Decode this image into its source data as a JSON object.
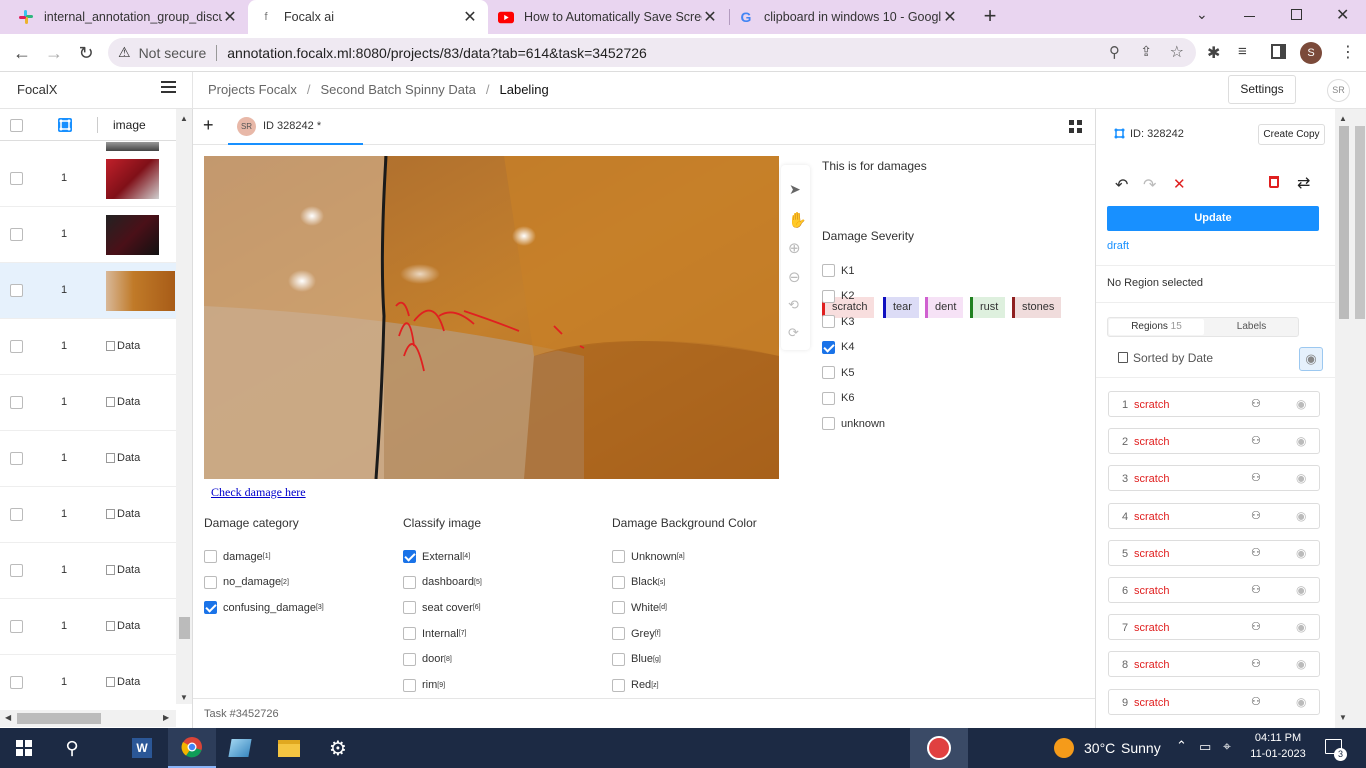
{
  "browser": {
    "tabs": [
      {
        "title": "internal_annotation_group_discu",
        "icon": "slack-icon",
        "active": false
      },
      {
        "title": "Focalx ai",
        "icon": "focalx-icon",
        "active": true
      },
      {
        "title": "How to Automatically Save Scree",
        "icon": "youtube-icon",
        "active": false
      },
      {
        "title": "clipboard in windows 10 - Googl",
        "icon": "google-icon",
        "active": false
      }
    ],
    "security_label": "Not secure",
    "url": "annotation.focalx.ml:8080/projects/83/data?tab=614&task=3452726",
    "profile_initial": "S"
  },
  "app": {
    "logo": "FocalX",
    "breadcrumb": [
      "Projects Focalx",
      "Second Batch Spinny Data",
      "Labeling"
    ],
    "breadcrumb_sep": "/",
    "settings_label": "Settings",
    "user_initials": "SR"
  },
  "list": {
    "column_image": "image",
    "rows": [
      {
        "count": "1",
        "thumb": "red-car"
      },
      {
        "count": "1",
        "thumb": "dark-car"
      },
      {
        "count": "1",
        "thumb": "orange-car",
        "selected": true
      },
      {
        "count": "1",
        "thumb": "broken",
        "alt": "Data"
      },
      {
        "count": "1",
        "thumb": "broken",
        "alt": "Data"
      },
      {
        "count": "1",
        "thumb": "broken",
        "alt": "Data"
      },
      {
        "count": "1",
        "thumb": "broken",
        "alt": "Data"
      },
      {
        "count": "1",
        "thumb": "broken",
        "alt": "Data"
      },
      {
        "count": "1",
        "thumb": "broken",
        "alt": "Data"
      },
      {
        "count": "1",
        "thumb": "broken",
        "alt": "Data"
      }
    ]
  },
  "editor": {
    "tab_initials": "SR",
    "tab_label": "ID 328242 *",
    "add_label": "+",
    "link_text": "Check damage here",
    "task_label": "Task #3452726",
    "damages_title": "This is for damages",
    "damage_tags": [
      {
        "label": "scratch",
        "color": "#e02020",
        "bg": "#f8dede"
      },
      {
        "label": "tear",
        "color": "#1010c0",
        "bg": "#dcdcf6"
      },
      {
        "label": "dent",
        "color": "#d060d0",
        "bg": "#f6e2f6"
      },
      {
        "label": "rust",
        "color": "#208020",
        "bg": "#def0de"
      },
      {
        "label": "stones",
        "color": "#902020",
        "bg": "#f0dcdc"
      }
    ],
    "severity_title": "Damage Severity",
    "severity": [
      {
        "label": "K1",
        "checked": false
      },
      {
        "label": "K2",
        "checked": false
      },
      {
        "label": "K3",
        "checked": false
      },
      {
        "label": "K4",
        "checked": true
      },
      {
        "label": "K5",
        "checked": false
      },
      {
        "label": "K6",
        "checked": false
      },
      {
        "label": "unknown",
        "checked": false
      }
    ],
    "category_title": "Damage category",
    "category": [
      {
        "label": "damage",
        "key": "[1]",
        "checked": false
      },
      {
        "label": "no_damage",
        "key": "[2]",
        "checked": false
      },
      {
        "label": "confusing_damage",
        "key": "[3]",
        "checked": true
      }
    ],
    "classify_title": "Classify image",
    "classify": [
      {
        "label": "External",
        "key": "[4]",
        "checked": true
      },
      {
        "label": "dashboard",
        "key": "[5]",
        "checked": false
      },
      {
        "label": "seat cover",
        "key": "[6]",
        "checked": false
      },
      {
        "label": "Internal",
        "key": "[7]",
        "checked": false
      },
      {
        "label": "door",
        "key": "[8]",
        "checked": false
      },
      {
        "label": "rim",
        "key": "[9]",
        "checked": false
      }
    ],
    "bg_title": "Damage Background Color",
    "bg_colors": [
      {
        "label": "Unknown",
        "key": "[a]",
        "checked": false
      },
      {
        "label": "Black",
        "key": "[s]",
        "checked": false
      },
      {
        "label": "White",
        "key": "[d]",
        "checked": false
      },
      {
        "label": "Grey",
        "key": "[f]",
        "checked": false
      },
      {
        "label": "Blue",
        "key": "[g]",
        "checked": false
      },
      {
        "label": "Red",
        "key": "[z]",
        "checked": false
      }
    ]
  },
  "sidebar": {
    "id_label": "ID: 328242",
    "create_copy": "Create Copy",
    "update": "Update",
    "status": "draft",
    "no_region": "No Region selected",
    "regions_tab": "Regions",
    "regions_count": "15",
    "labels_tab": "Labels",
    "sorted": "Sorted by Date",
    "regions": [
      {
        "n": "1",
        "label": "scratch"
      },
      {
        "n": "2",
        "label": "scratch"
      },
      {
        "n": "3",
        "label": "scratch"
      },
      {
        "n": "4",
        "label": "scratch"
      },
      {
        "n": "5",
        "label": "scratch"
      },
      {
        "n": "6",
        "label": "scratch"
      },
      {
        "n": "7",
        "label": "scratch"
      },
      {
        "n": "8",
        "label": "scratch"
      },
      {
        "n": "9",
        "label": "scratch"
      }
    ],
    "accent": "#1890ff",
    "region_color": "#e02020"
  },
  "taskbar": {
    "weather_temp": "30°C",
    "weather_desc": "Sunny",
    "time": "04:11 PM",
    "date": "11-01-2023",
    "notifications": "3"
  }
}
